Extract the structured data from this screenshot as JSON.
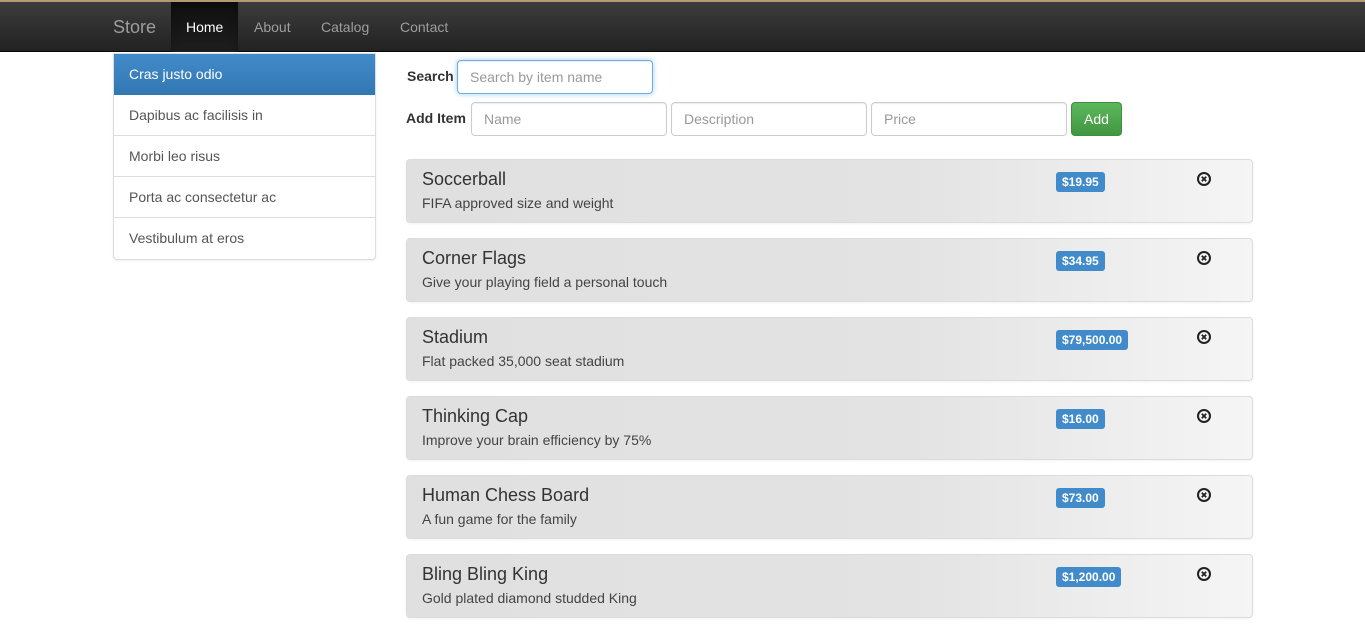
{
  "navbar": {
    "brand": "Store",
    "items": [
      {
        "label": "Home",
        "active": true
      },
      {
        "label": "About",
        "active": false
      },
      {
        "label": "Catalog",
        "active": false
      },
      {
        "label": "Contact",
        "active": false
      }
    ]
  },
  "sidebar": {
    "items": [
      {
        "label": "Cras justo odio",
        "active": true
      },
      {
        "label": "Dapibus ac facilisis in",
        "active": false
      },
      {
        "label": "Morbi leo risus",
        "active": false
      },
      {
        "label": "Porta ac consectetur ac",
        "active": false
      },
      {
        "label": "Vestibulum at eros",
        "active": false
      }
    ]
  },
  "search": {
    "label": "Search",
    "placeholder": "Search by item name",
    "value": ""
  },
  "add_item": {
    "label": "Add Item",
    "name_placeholder": "Name",
    "description_placeholder": "Description",
    "price_placeholder": "Price",
    "button_label": "Add"
  },
  "items": [
    {
      "name": "Soccerball",
      "description": "FIFA approved size and weight",
      "price": "$19.95",
      "remove_icon": "remove-circle-icon"
    },
    {
      "name": "Corner Flags",
      "description": "Give your playing field a personal touch",
      "price": "$34.95",
      "remove_icon": "remove-circle-icon"
    },
    {
      "name": "Stadium",
      "description": "Flat packed 35,000 seat stadium",
      "price": "$79,500.00",
      "remove_icon": "remove-circle-icon"
    },
    {
      "name": "Thinking Cap",
      "description": "Improve your brain efficiency by 75%",
      "price": "$16.00",
      "remove_icon": "remove-circle-icon"
    },
    {
      "name": "Human Chess Board",
      "description": "A fun game for the family",
      "price": "$73.00",
      "remove_icon": "remove-circle-icon"
    },
    {
      "name": "Bling Bling King",
      "description": "Gold plated diamond studded King",
      "price": "$1,200.00",
      "remove_icon": "remove-circle-icon"
    }
  ],
  "colors": {
    "primary": "#428bca",
    "success": "#5cb85c",
    "navbar": "#222222"
  }
}
